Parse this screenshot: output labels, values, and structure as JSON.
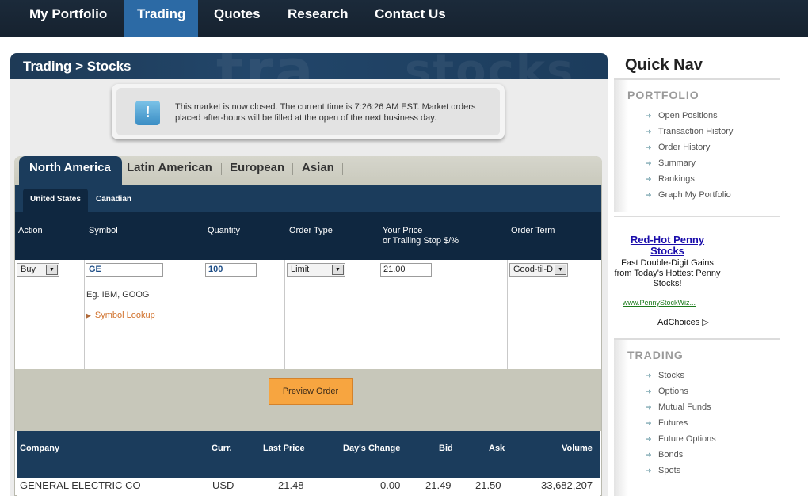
{
  "nav": {
    "items": [
      "My Portfolio",
      "Trading",
      "Quotes",
      "Research",
      "Contact Us"
    ],
    "active": "Trading"
  },
  "page": {
    "breadcrumb": "Trading > Stocks",
    "watermark_1": "tra",
    "watermark_2": "stocks"
  },
  "notice": {
    "icon": "info-icon",
    "icon_glyph": "!",
    "message": "This market is now closed. The current time is 7:26:26 AM EST. Market orders placed after-hours will be filled at the open of the next business day."
  },
  "regions": [
    "North America",
    "Latin American",
    "European",
    "Asian"
  ],
  "subtabs": [
    "United States",
    "Canadian"
  ],
  "order_form": {
    "headers": {
      "action": "Action",
      "symbol": "Symbol",
      "quantity": "Quantity",
      "order_type": "Order Type",
      "price_line1": "Your Price",
      "price_line2": "or Trailing Stop $/%",
      "order_term": "Order Term"
    },
    "action_value": "Buy",
    "symbol_value": "GE",
    "symbol_hint": "Eg. IBM, GOOG",
    "symbol_lookup": "Symbol Lookup",
    "quantity_value": "100",
    "order_type_value": "Limit",
    "price_value": "21.00",
    "order_term_value": "Good-til-D"
  },
  "preview_button": "Preview Order",
  "quote": {
    "headers": [
      "Company",
      "Curr.",
      "Last Price",
      "Day's Change",
      "Bid",
      "Ask",
      "Volume"
    ],
    "row": {
      "company": "GENERAL ELECTRIC CO",
      "currency": "USD",
      "last_price": "21.48",
      "days_change": "0.00",
      "bid": "21.49",
      "ask": "21.50",
      "volume": "33,682,207"
    }
  },
  "quick_nav": {
    "title": "Quick Nav",
    "portfolio_heading": "PORTFOLIO",
    "portfolio_links": [
      "Open Positions",
      "Transaction History",
      "Order History",
      "Summary",
      "Rankings",
      "Graph My Portfolio"
    ],
    "trading_heading": "TRADING",
    "trading_links": [
      "Stocks",
      "Options",
      "Mutual Funds",
      "Futures",
      "Future Options",
      "Bonds",
      "Spots"
    ]
  },
  "ad": {
    "title": "Red-Hot Penny Stocks",
    "text": "Fast Double-Digit Gains from Today's Hottest Penny Stocks!",
    "url": "www.PennyStockWiz...",
    "choices": "AdChoices"
  },
  "colors": {
    "nav_bg": "#1b2a3a",
    "nav_active": "#2c6aa5",
    "panel_dark": "#1b3c5c",
    "button_orange": "#f7a540"
  }
}
